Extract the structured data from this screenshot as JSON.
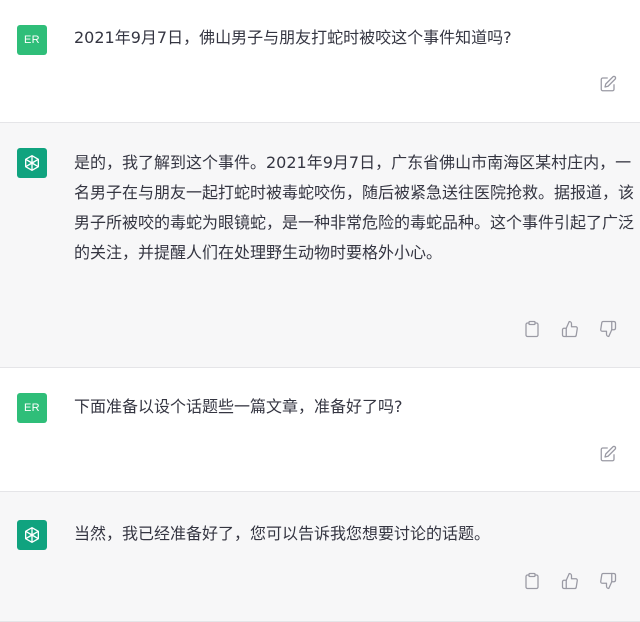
{
  "conversation": {
    "messages": [
      {
        "role": "user",
        "avatar_text": "ER",
        "text": "2021年9月7日，佛山男子与朋友打蛇时被咬这个事件知道吗?",
        "actions": [
          "edit-icon"
        ]
      },
      {
        "role": "assistant",
        "text": "是的，我了解到这个事件。2021年9月7日，广东省佛山市南海区某村庄内，一名男子在与朋友一起打蛇时被毒蛇咬伤，随后被紧急送往医院抢救。据报道，该男子所被咬的毒蛇为眼镜蛇，是一种非常危险的毒蛇品种。这个事件引起了广泛的关注，并提醒人们在处理野生动物时要格外小心。",
        "actions": [
          "clipboard-icon",
          "thumbs-up-icon",
          "thumbs-down-icon"
        ]
      },
      {
        "role": "user",
        "avatar_text": "ER",
        "text": "下面准备以设个话题些一篇文章，准备好了吗?",
        "actions": [
          "edit-icon"
        ]
      },
      {
        "role": "assistant",
        "text": "当然，我已经准备好了，您可以告诉我您想要讨论的话题。",
        "actions": [
          "clipboard-icon",
          "thumbs-up-icon",
          "thumbs-down-icon"
        ]
      }
    ]
  },
  "colors": {
    "user_avatar": "#2fbe79",
    "assistant_avatar": "#10a37f",
    "assistant_bg": "#f7f7f8",
    "text": "#343541",
    "icon": "#9a9aa4"
  }
}
